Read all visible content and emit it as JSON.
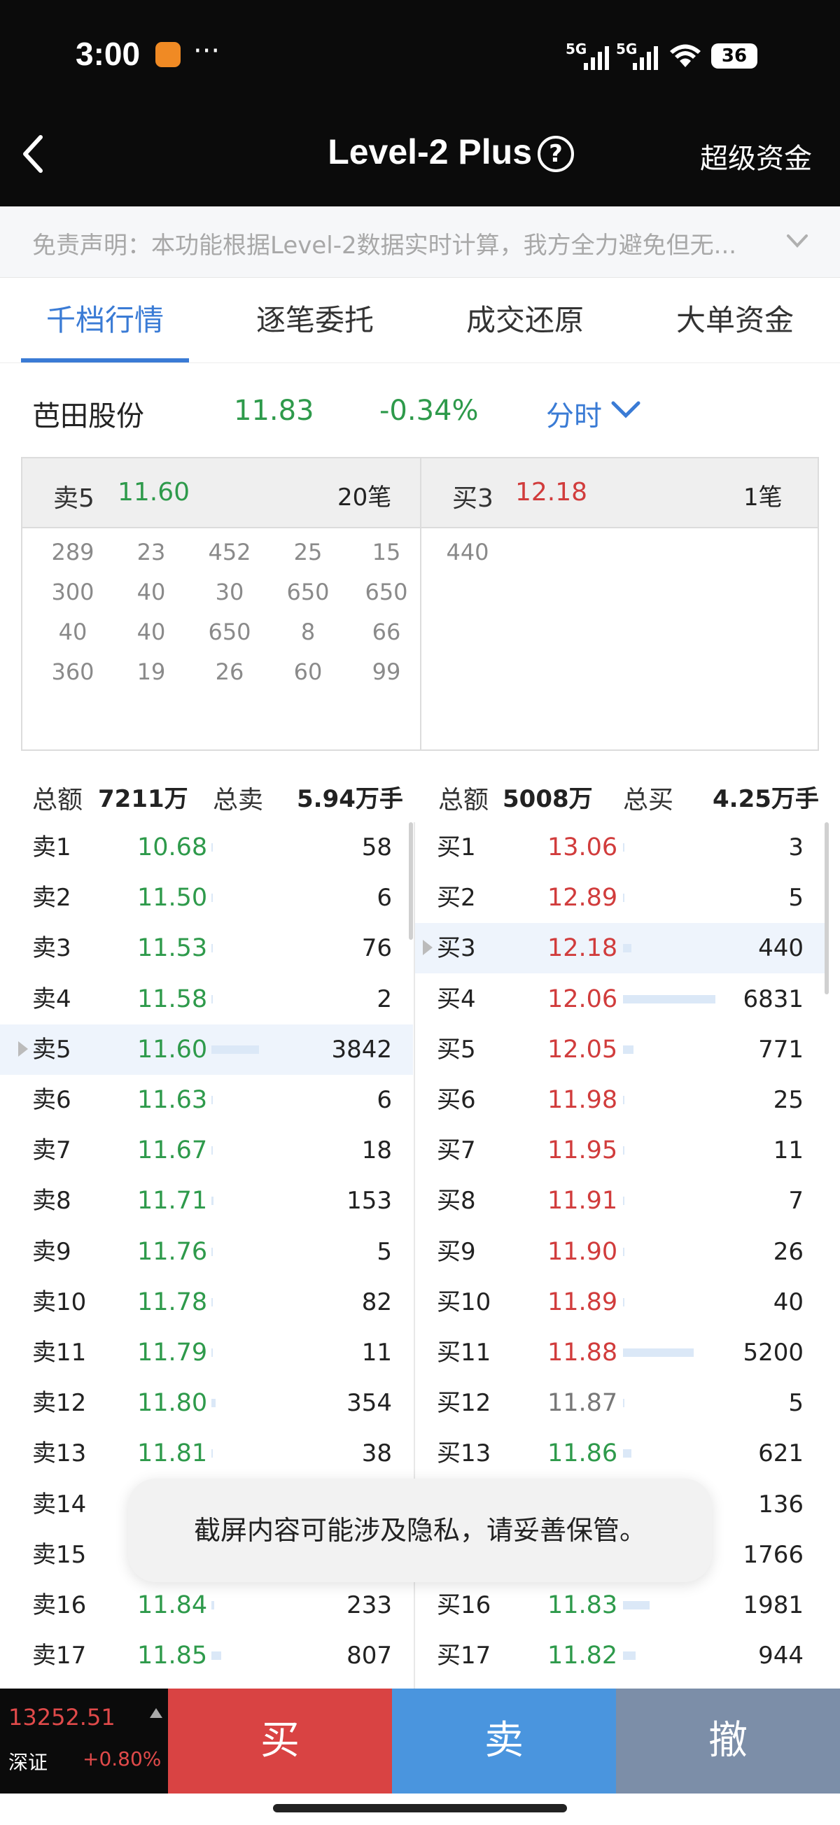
{
  "status": {
    "time": "3:00",
    "dots": "···",
    "signal1": "5G",
    "signal2": "5G",
    "battery": "36"
  },
  "nav": {
    "title": "Level-2 Plus",
    "right_label": "超级资金"
  },
  "disclaimer": "免责声明：本功能根据Level-2数据实时计算，我方全力避免但无...",
  "tabs": [
    "千档行情",
    "逐笔委托",
    "成交还原",
    "大单资金"
  ],
  "stock": {
    "name": "芭田股份",
    "price": "11.83",
    "change": "-0.34%",
    "mode": "分时"
  },
  "tick_panel": {
    "left": {
      "label": "卖5",
      "price": "11.60",
      "count": "20笔",
      "rows": [
        [
          "289",
          "23",
          "452",
          "25",
          "15"
        ],
        [
          "300",
          "40",
          "30",
          "650",
          "650"
        ],
        [
          "40",
          "40",
          "650",
          "8",
          "66"
        ],
        [
          "360",
          "19",
          "26",
          "60",
          "99"
        ]
      ]
    },
    "right": {
      "label": "买3",
      "price": "12.18",
      "count": "1笔",
      "rows": [
        [
          "440"
        ]
      ]
    }
  },
  "summary": {
    "sell": {
      "amount_label": "总额",
      "amount": "7211万",
      "total_label": "总卖",
      "total": "5.94万手"
    },
    "buy": {
      "amount_label": "总额",
      "amount": "5008万",
      "total_label": "总买",
      "total": "4.25万手"
    }
  },
  "sell_rows": [
    {
      "label": "卖1",
      "price": "10.68",
      "vol": "58",
      "bar": 0.005
    },
    {
      "label": "卖2",
      "price": "11.50",
      "vol": "6",
      "bar": 0.001
    },
    {
      "label": "卖3",
      "price": "11.53",
      "vol": "76",
      "bar": 0.006
    },
    {
      "label": "卖4",
      "price": "11.58",
      "vol": "2",
      "bar": 0.0
    },
    {
      "label": "卖5",
      "price": "11.60",
      "vol": "3842",
      "bar": 0.31,
      "highlight": true
    },
    {
      "label": "卖6",
      "price": "11.63",
      "vol": "6",
      "bar": 0.001
    },
    {
      "label": "卖7",
      "price": "11.67",
      "vol": "18",
      "bar": 0.002
    },
    {
      "label": "卖8",
      "price": "11.71",
      "vol": "153",
      "bar": 0.012
    },
    {
      "label": "卖9",
      "price": "11.76",
      "vol": "5",
      "bar": 0.0
    },
    {
      "label": "卖10",
      "price": "11.78",
      "vol": "82",
      "bar": 0.007
    },
    {
      "label": "卖11",
      "price": "11.79",
      "vol": "11",
      "bar": 0.001
    },
    {
      "label": "卖12",
      "price": "11.80",
      "vol": "354",
      "bar": 0.029
    },
    {
      "label": "卖13",
      "price": "11.81",
      "vol": "38",
      "bar": 0.003
    },
    {
      "label": "卖14",
      "price": "",
      "vol": "",
      "bar": 0.0
    },
    {
      "label": "卖15",
      "price": "",
      "vol": "",
      "bar": 0.0
    },
    {
      "label": "卖16",
      "price": "11.84",
      "vol": "233",
      "bar": 0.019
    },
    {
      "label": "卖17",
      "price": "11.85",
      "vol": "807",
      "bar": 0.065
    }
  ],
  "buy_rows": [
    {
      "label": "买1",
      "price": "13.06",
      "vol": "3",
      "color": "red",
      "bar": 0.0
    },
    {
      "label": "买2",
      "price": "12.89",
      "vol": "5",
      "color": "red",
      "bar": 0.0
    },
    {
      "label": "买3",
      "price": "12.18",
      "vol": "440",
      "color": "red",
      "bar": 0.048,
      "highlight": true
    },
    {
      "label": "买4",
      "price": "12.06",
      "vol": "6831",
      "color": "red",
      "bar": 0.55
    },
    {
      "label": "买5",
      "price": "12.05",
      "vol": "771",
      "color": "red",
      "bar": 0.062
    },
    {
      "label": "买6",
      "price": "11.98",
      "vol": "25",
      "color": "red",
      "bar": 0.002
    },
    {
      "label": "买7",
      "price": "11.95",
      "vol": "11",
      "color": "red",
      "bar": 0.001
    },
    {
      "label": "买8",
      "price": "11.91",
      "vol": "7",
      "color": "red",
      "bar": 0.0
    },
    {
      "label": "买9",
      "price": "11.90",
      "vol": "26",
      "color": "red",
      "bar": 0.002
    },
    {
      "label": "买10",
      "price": "11.89",
      "vol": "40",
      "color": "red",
      "bar": 0.003
    },
    {
      "label": "买11",
      "price": "11.88",
      "vol": "5200",
      "color": "red",
      "bar": 0.42
    },
    {
      "label": "买12",
      "price": "11.87",
      "vol": "5",
      "color": "grey",
      "bar": 0.0
    },
    {
      "label": "买13",
      "price": "11.86",
      "vol": "621",
      "color": "green",
      "bar": 0.05
    },
    {
      "label": "",
      "price": "",
      "vol": "136",
      "color": "green",
      "bar": 0.0
    },
    {
      "label": "",
      "price": "",
      "vol": "1766",
      "color": "green",
      "bar": 0.0
    },
    {
      "label": "买16",
      "price": "11.83",
      "vol": "1981",
      "color": "green",
      "bar": 0.16
    },
    {
      "label": "买17",
      "price": "11.82",
      "vol": "944",
      "color": "green",
      "bar": 0.076
    }
  ],
  "toast": "截屏内容可能涉及隐私，请妥善保管。",
  "index": {
    "value": "13252.51",
    "name": "深证",
    "change": "+0.80%"
  },
  "actions": {
    "buy": "买",
    "sell": "卖",
    "cancel": "撤"
  },
  "colors": {
    "green": "#2e9a4b",
    "red": "#d13c3c",
    "accent": "#3a7bd5",
    "buy_btn": "#d94343",
    "sell_btn": "#4a95de",
    "cancel_btn": "#7c8ea8"
  }
}
